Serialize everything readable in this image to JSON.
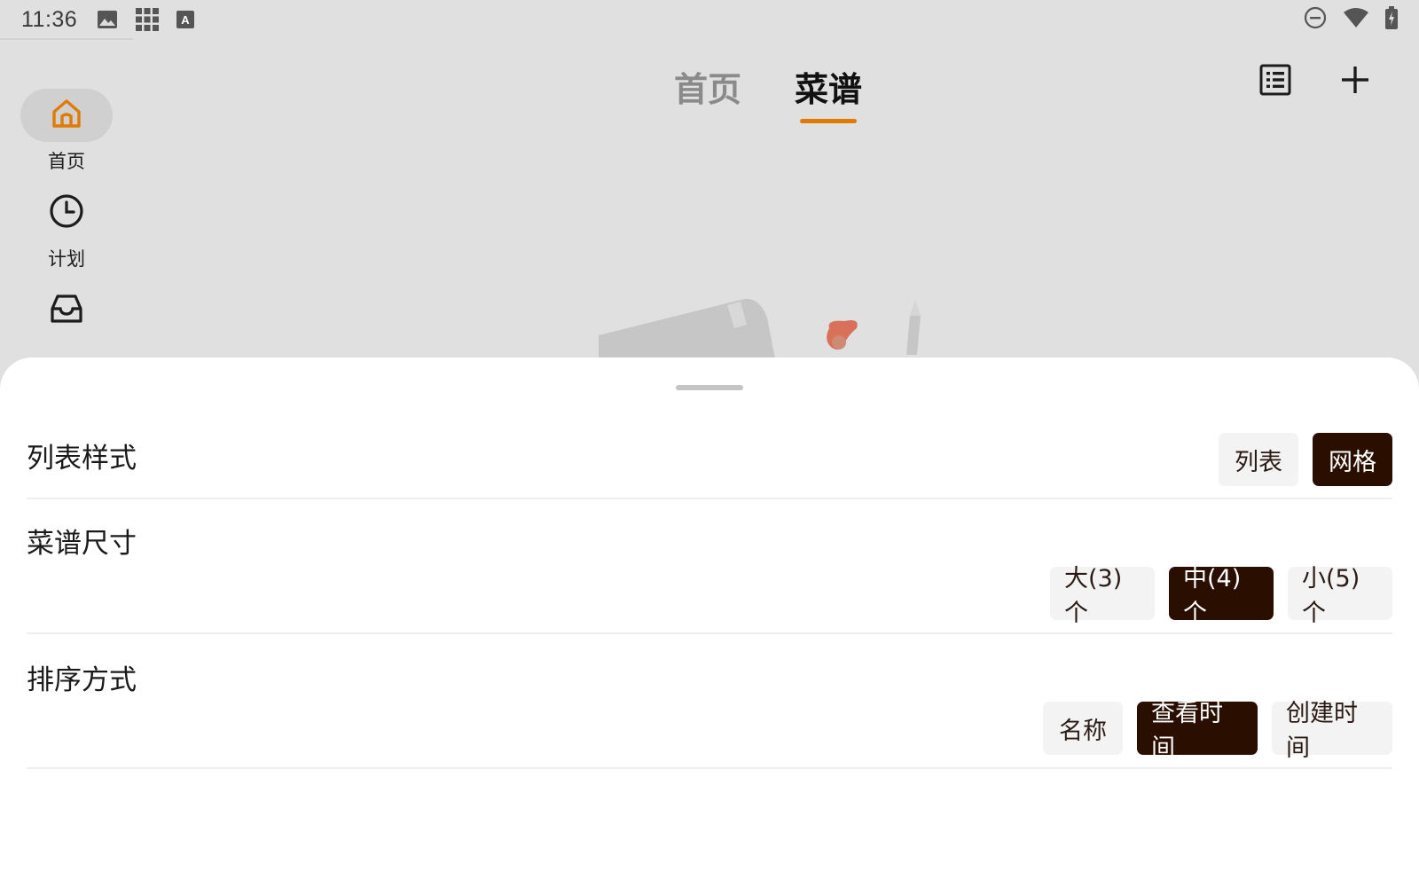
{
  "status_bar": {
    "time": "11:36",
    "left_icons": [
      "image-icon",
      "grid-apps-icon",
      "font-a-icon"
    ],
    "right_icons": [
      "do-not-disturb-icon",
      "wifi-icon",
      "battery-charging-icon"
    ]
  },
  "nav_rail": {
    "items": [
      {
        "label": "首页",
        "icon": "home-icon",
        "active": true
      },
      {
        "label": "计划",
        "icon": "clock-icon",
        "active": false
      },
      {
        "label": "",
        "icon": "inbox-icon",
        "active": false
      }
    ]
  },
  "top_tabs": [
    {
      "label": "首页",
      "active": false
    },
    {
      "label": "菜谱",
      "active": true
    }
  ],
  "top_actions": [
    "list-view-icon",
    "add-icon"
  ],
  "sheet": {
    "rows": [
      {
        "title": "列表样式",
        "options": [
          {
            "label": "列表",
            "selected": false
          },
          {
            "label": "网格",
            "selected": true
          }
        ]
      },
      {
        "title": "菜谱尺寸",
        "options": [
          {
            "label": "大(3)个",
            "selected": false
          },
          {
            "label": "中(4)个",
            "selected": true
          },
          {
            "label": "小(5)个",
            "selected": false
          }
        ]
      },
      {
        "title": "排序方式",
        "options": [
          {
            "label": "名称",
            "selected": false
          },
          {
            "label": "查看时间",
            "selected": true
          },
          {
            "label": "创建时间",
            "selected": false
          }
        ]
      }
    ]
  },
  "colors": {
    "accent": "#e07b00",
    "chip_selected": "#2a0e00",
    "chip_default": "#f3f3f3",
    "background": "#e0e0e0"
  }
}
